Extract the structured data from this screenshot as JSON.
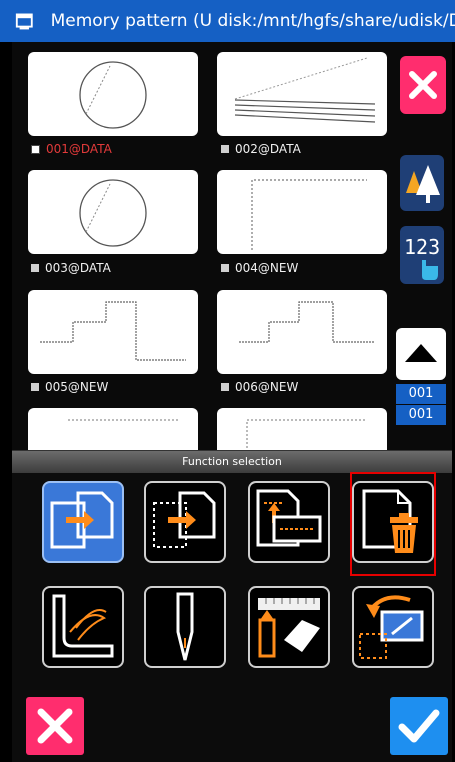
{
  "window": {
    "title": "Memory pattern (U disk:/mnt/hgfs/share/udisk/DH_"
  },
  "patterns": [
    {
      "label": "001@DATA",
      "selected": true,
      "shape": "circle"
    },
    {
      "label": "002@DATA",
      "selected": false,
      "shape": "lines"
    },
    {
      "label": "003@DATA",
      "selected": false,
      "shape": "circle"
    },
    {
      "label": "004@NEW",
      "selected": false,
      "shape": "corner"
    },
    {
      "label": "005@NEW",
      "selected": false,
      "shape": "step"
    },
    {
      "label": "006@NEW",
      "selected": false,
      "shape": "step2"
    }
  ],
  "pager": {
    "current": "001",
    "total": "001"
  },
  "dialog": {
    "title": "Function selection",
    "functions": [
      {
        "icon": "copy-file-icon",
        "active": true
      },
      {
        "icon": "move-file-icon",
        "active": false
      },
      {
        "icon": "save-as-file-icon",
        "active": false
      },
      {
        "icon": "delete-file-icon",
        "active": false,
        "highlighted": true
      },
      {
        "icon": "stitch-edit-icon",
        "active": false
      },
      {
        "icon": "needle-icon",
        "active": false
      },
      {
        "icon": "ruler-eraser-icon",
        "active": false
      },
      {
        "icon": "transform-scale-icon",
        "active": false
      }
    ]
  },
  "colors": {
    "titlebar": "#1560c4",
    "close": "#ff2d6e",
    "confirm": "#1e8ff0",
    "active": "#3a78d8",
    "highlight": "#e60000",
    "selected_label": "#e23a3a"
  }
}
